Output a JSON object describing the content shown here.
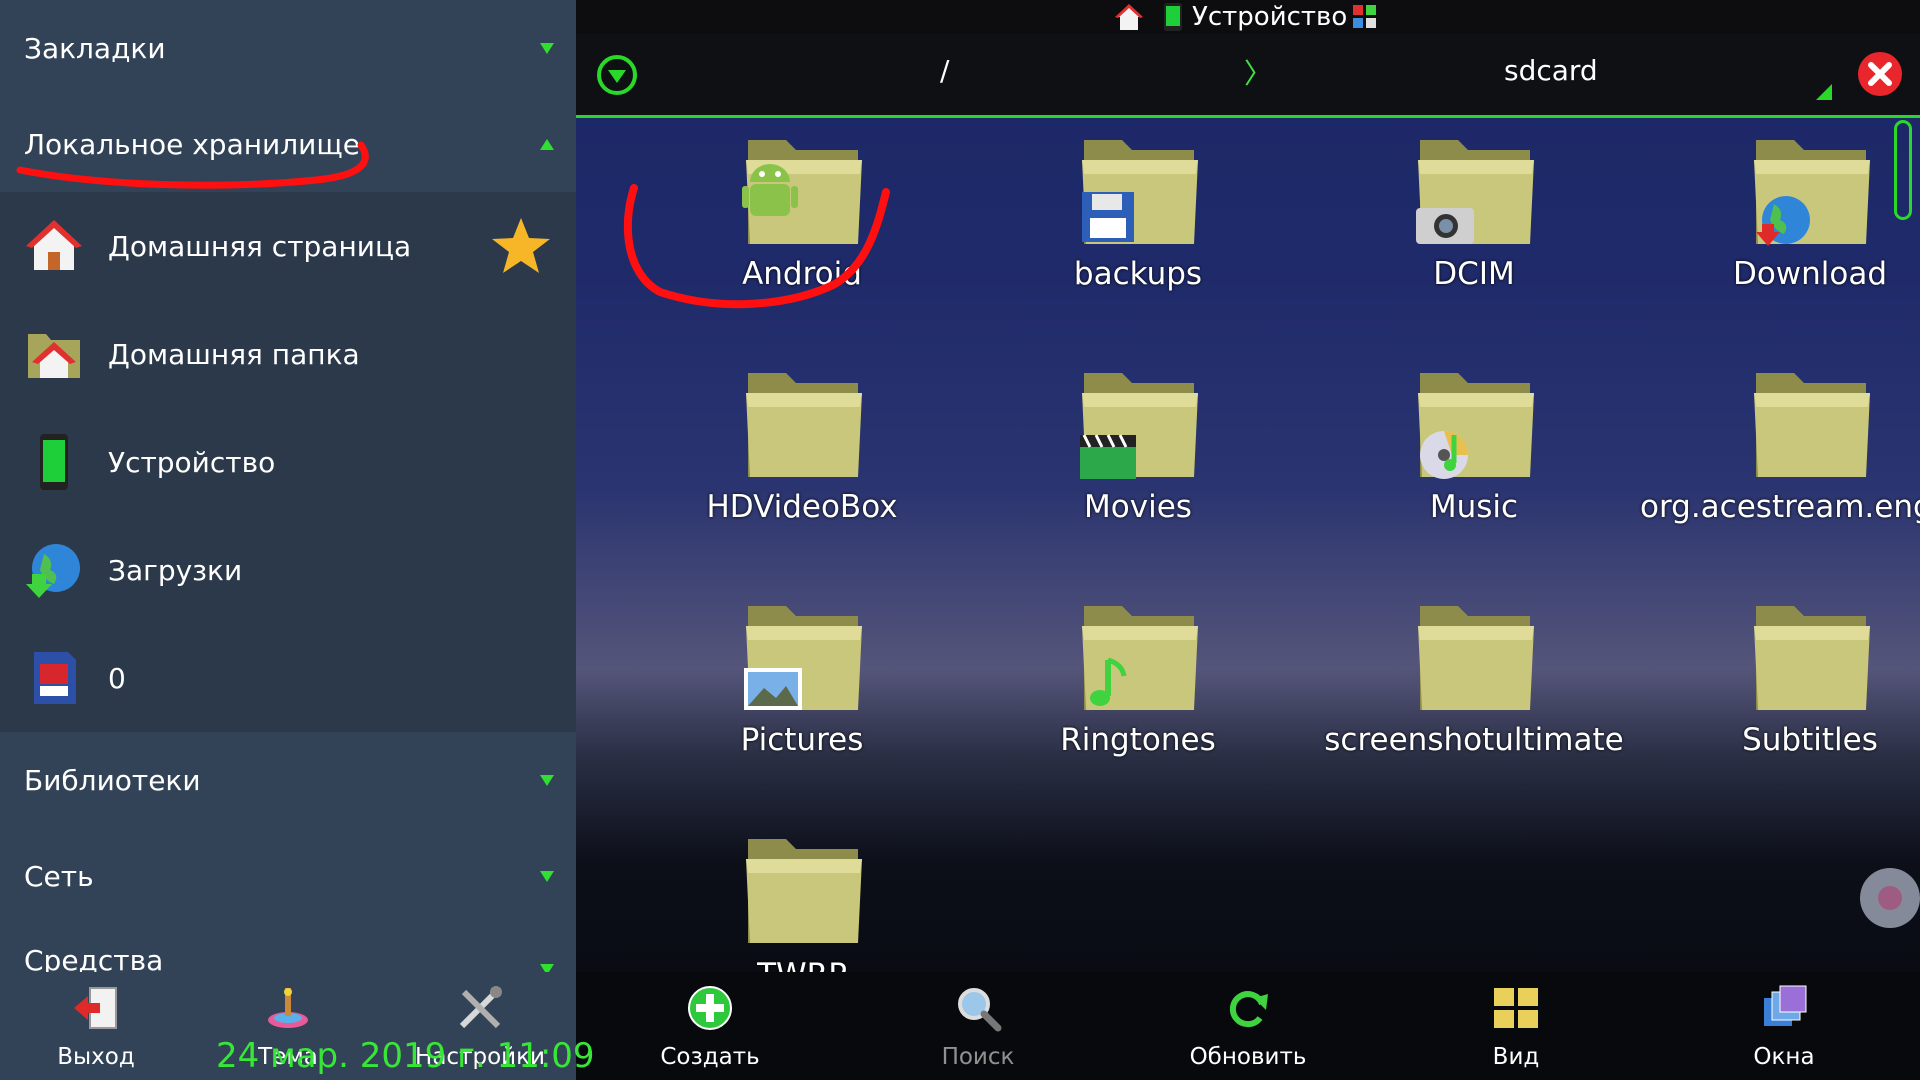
{
  "sidebar": {
    "bookmarks_label": "Закладки",
    "local_label": "Локальное хранилище",
    "items": [
      {
        "label": "Домашняя страница",
        "icon": "home-icon"
      },
      {
        "label": "Домашняя папка",
        "icon": "home-folder-icon"
      },
      {
        "label": "Устройство",
        "icon": "phone-icon"
      },
      {
        "label": "Загрузки",
        "icon": "globe-download-icon"
      },
      {
        "label": "0",
        "icon": "sd-card-icon"
      }
    ],
    "libraries_label": "Библиотеки",
    "network_label": "Сеть",
    "tools_label": "Средства",
    "toolbar": [
      {
        "label": "Выход",
        "icon": "exit-icon"
      },
      {
        "label": "Тема",
        "icon": "theme-icon"
      },
      {
        "label": "Настройки",
        "icon": "settings-tools-icon"
      }
    ]
  },
  "topbar": {
    "title": "Устройство"
  },
  "address": {
    "root": "/",
    "separator": "〉",
    "current": "sdcard"
  },
  "folders": [
    {
      "name": "Android",
      "badge": "android-icon"
    },
    {
      "name": "backups",
      "badge": "floppy-icon"
    },
    {
      "name": "DCIM",
      "badge": "camera-icon"
    },
    {
      "name": "Download",
      "badge": "globe-download-icon"
    },
    {
      "name": "HDVideoBox",
      "badge": ""
    },
    {
      "name": "Movies",
      "badge": "clapper-icon"
    },
    {
      "name": "Music",
      "badge": "cd-music-icon"
    },
    {
      "name": "org.acestream.engine",
      "badge": ""
    },
    {
      "name": "Pictures",
      "badge": "picture-icon"
    },
    {
      "name": "Ringtones",
      "badge": "note-icon"
    },
    {
      "name": "screenshotultimate",
      "badge": ""
    },
    {
      "name": "Subtitles",
      "badge": ""
    },
    {
      "name": "TWRP",
      "badge": ""
    }
  ],
  "main_toolbar": [
    {
      "label": "Создать",
      "icon": "plus-icon"
    },
    {
      "label": "Поиск",
      "icon": "search-icon"
    },
    {
      "label": "Обновить",
      "icon": "refresh-icon"
    },
    {
      "label": "Вид",
      "icon": "view-grid-icon"
    },
    {
      "label": "Окна",
      "icon": "windows-icon"
    }
  ],
  "datetime": "24 мар. 2019 г. 11:09",
  "colors": {
    "accent": "#2ad82a",
    "sidebar": "#334357",
    "annotation": "#ff1010"
  }
}
